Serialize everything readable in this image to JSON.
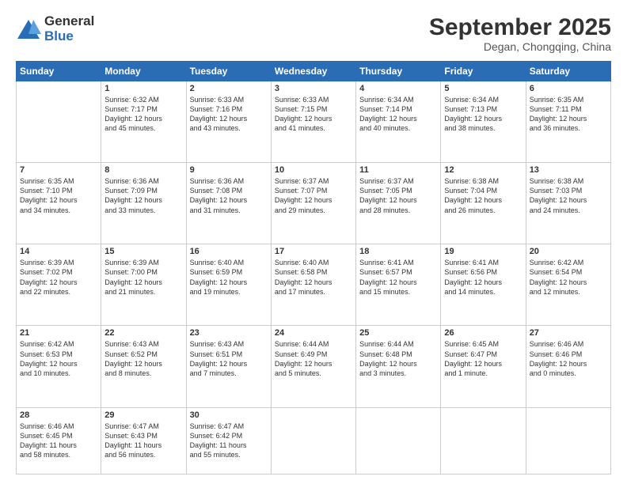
{
  "header": {
    "logo_general": "General",
    "logo_blue": "Blue",
    "month_year": "September 2025",
    "location": "Degan, Chongqing, China"
  },
  "days_of_week": [
    "Sunday",
    "Monday",
    "Tuesday",
    "Wednesday",
    "Thursday",
    "Friday",
    "Saturday"
  ],
  "weeks": [
    [
      {
        "day": "",
        "info": ""
      },
      {
        "day": "1",
        "info": "Sunrise: 6:32 AM\nSunset: 7:17 PM\nDaylight: 12 hours\nand 45 minutes."
      },
      {
        "day": "2",
        "info": "Sunrise: 6:33 AM\nSunset: 7:16 PM\nDaylight: 12 hours\nand 43 minutes."
      },
      {
        "day": "3",
        "info": "Sunrise: 6:33 AM\nSunset: 7:15 PM\nDaylight: 12 hours\nand 41 minutes."
      },
      {
        "day": "4",
        "info": "Sunrise: 6:34 AM\nSunset: 7:14 PM\nDaylight: 12 hours\nand 40 minutes."
      },
      {
        "day": "5",
        "info": "Sunrise: 6:34 AM\nSunset: 7:13 PM\nDaylight: 12 hours\nand 38 minutes."
      },
      {
        "day": "6",
        "info": "Sunrise: 6:35 AM\nSunset: 7:11 PM\nDaylight: 12 hours\nand 36 minutes."
      }
    ],
    [
      {
        "day": "7",
        "info": "Sunrise: 6:35 AM\nSunset: 7:10 PM\nDaylight: 12 hours\nand 34 minutes."
      },
      {
        "day": "8",
        "info": "Sunrise: 6:36 AM\nSunset: 7:09 PM\nDaylight: 12 hours\nand 33 minutes."
      },
      {
        "day": "9",
        "info": "Sunrise: 6:36 AM\nSunset: 7:08 PM\nDaylight: 12 hours\nand 31 minutes."
      },
      {
        "day": "10",
        "info": "Sunrise: 6:37 AM\nSunset: 7:07 PM\nDaylight: 12 hours\nand 29 minutes."
      },
      {
        "day": "11",
        "info": "Sunrise: 6:37 AM\nSunset: 7:05 PM\nDaylight: 12 hours\nand 28 minutes."
      },
      {
        "day": "12",
        "info": "Sunrise: 6:38 AM\nSunset: 7:04 PM\nDaylight: 12 hours\nand 26 minutes."
      },
      {
        "day": "13",
        "info": "Sunrise: 6:38 AM\nSunset: 7:03 PM\nDaylight: 12 hours\nand 24 minutes."
      }
    ],
    [
      {
        "day": "14",
        "info": "Sunrise: 6:39 AM\nSunset: 7:02 PM\nDaylight: 12 hours\nand 22 minutes."
      },
      {
        "day": "15",
        "info": "Sunrise: 6:39 AM\nSunset: 7:00 PM\nDaylight: 12 hours\nand 21 minutes."
      },
      {
        "day": "16",
        "info": "Sunrise: 6:40 AM\nSunset: 6:59 PM\nDaylight: 12 hours\nand 19 minutes."
      },
      {
        "day": "17",
        "info": "Sunrise: 6:40 AM\nSunset: 6:58 PM\nDaylight: 12 hours\nand 17 minutes."
      },
      {
        "day": "18",
        "info": "Sunrise: 6:41 AM\nSunset: 6:57 PM\nDaylight: 12 hours\nand 15 minutes."
      },
      {
        "day": "19",
        "info": "Sunrise: 6:41 AM\nSunset: 6:56 PM\nDaylight: 12 hours\nand 14 minutes."
      },
      {
        "day": "20",
        "info": "Sunrise: 6:42 AM\nSunset: 6:54 PM\nDaylight: 12 hours\nand 12 minutes."
      }
    ],
    [
      {
        "day": "21",
        "info": "Sunrise: 6:42 AM\nSunset: 6:53 PM\nDaylight: 12 hours\nand 10 minutes."
      },
      {
        "day": "22",
        "info": "Sunrise: 6:43 AM\nSunset: 6:52 PM\nDaylight: 12 hours\nand 8 minutes."
      },
      {
        "day": "23",
        "info": "Sunrise: 6:43 AM\nSunset: 6:51 PM\nDaylight: 12 hours\nand 7 minutes."
      },
      {
        "day": "24",
        "info": "Sunrise: 6:44 AM\nSunset: 6:49 PM\nDaylight: 12 hours\nand 5 minutes."
      },
      {
        "day": "25",
        "info": "Sunrise: 6:44 AM\nSunset: 6:48 PM\nDaylight: 12 hours\nand 3 minutes."
      },
      {
        "day": "26",
        "info": "Sunrise: 6:45 AM\nSunset: 6:47 PM\nDaylight: 12 hours\nand 1 minute."
      },
      {
        "day": "27",
        "info": "Sunrise: 6:46 AM\nSunset: 6:46 PM\nDaylight: 12 hours\nand 0 minutes."
      }
    ],
    [
      {
        "day": "28",
        "info": "Sunrise: 6:46 AM\nSunset: 6:45 PM\nDaylight: 11 hours\nand 58 minutes."
      },
      {
        "day": "29",
        "info": "Sunrise: 6:47 AM\nSunset: 6:43 PM\nDaylight: 11 hours\nand 56 minutes."
      },
      {
        "day": "30",
        "info": "Sunrise: 6:47 AM\nSunset: 6:42 PM\nDaylight: 11 hours\nand 55 minutes."
      },
      {
        "day": "",
        "info": ""
      },
      {
        "day": "",
        "info": ""
      },
      {
        "day": "",
        "info": ""
      },
      {
        "day": "",
        "info": ""
      }
    ]
  ]
}
